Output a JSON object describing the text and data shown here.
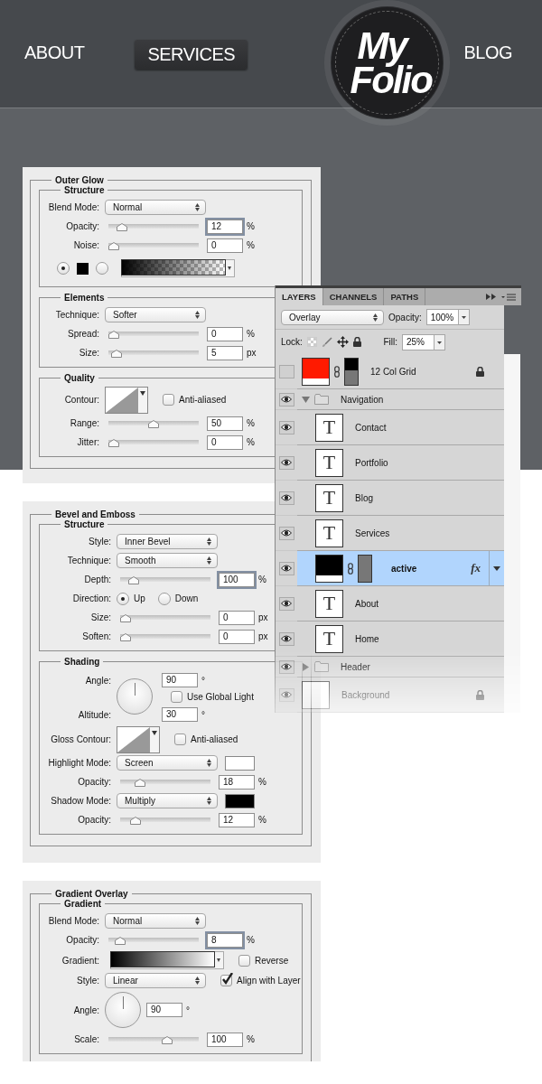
{
  "nav": {
    "items": [
      {
        "label": "ABOUT",
        "selected": false
      },
      {
        "label": "SERVICES",
        "selected": true
      },
      {
        "label": "BLOG",
        "selected": false
      }
    ],
    "logo": {
      "lines": [
        "My",
        "Folio"
      ]
    }
  },
  "panels": [
    {
      "title": "Outer Glow",
      "sections": [
        {
          "title": "Structure",
          "rows": [
            {
              "kind": "select",
              "label": "Blend Mode:",
              "value": "Normal"
            },
            {
              "kind": "slider",
              "label": "Opacity:",
              "level": 0.1,
              "value": "12",
              "unit": "%",
              "focused": true
            },
            {
              "kind": "slider",
              "label": "Noise:",
              "level": 0,
              "value": "0",
              "unit": "%",
              "focused": false
            },
            {
              "kind": "fill",
              "options": [
                {
                  "kind": "color",
                  "selected": true,
                  "color": "#000000"
                },
                {
                  "kind": "gradient",
                  "selected": false
                }
              ]
            }
          ]
        },
        {
          "title": "Elements",
          "rows": [
            {
              "kind": "select",
              "label": "Technique:",
              "value": "Softer"
            },
            {
              "kind": "slider",
              "label": "Spread:",
              "level": 0,
              "value": "0",
              "unit": "%",
              "focused": false
            },
            {
              "kind": "slider",
              "label": "Size:",
              "level": 0.03,
              "value": "5",
              "unit": "px",
              "focused": false
            }
          ]
        },
        {
          "title": "Quality",
          "rows": [
            {
              "kind": "contour",
              "label": "Contour:",
              "checkbox": {
                "label": "Anti-aliased",
                "checked": false
              }
            },
            {
              "kind": "slider",
              "label": "Range:",
              "level": 0.5,
              "value": "50",
              "unit": "%",
              "focused": false
            },
            {
              "kind": "slider",
              "label": "Jitter:",
              "level": 0,
              "value": "0",
              "unit": "%",
              "focused": false
            }
          ]
        }
      ]
    },
    {
      "title": "Bevel and Emboss",
      "sections": [
        {
          "title": "Structure",
          "rows": [
            {
              "kind": "select",
              "label": "Style:",
              "value": "Inner Bevel"
            },
            {
              "kind": "select",
              "label": "Technique:",
              "value": "Smooth"
            },
            {
              "kind": "slider",
              "label": "Depth:",
              "level": 0.1,
              "value": "100",
              "unit": "%",
              "focused": true
            },
            {
              "kind": "radios",
              "label": "Direction:",
              "options": [
                {
                  "label": "Up",
                  "selected": true
                },
                {
                  "label": "Down",
                  "selected": false
                }
              ]
            },
            {
              "kind": "slider",
              "label": "Size:",
              "level": 0,
              "value": "0",
              "unit": "px",
              "focused": false
            },
            {
              "kind": "slider",
              "label": "Soften:",
              "level": 0,
              "value": "0",
              "unit": "px",
              "focused": false
            }
          ]
        },
        {
          "title": "Shading",
          "rows": [
            {
              "kind": "light",
              "angle": {
                "label": "Angle:",
                "value": "90",
                "unit": "°"
              },
              "checkbox": {
                "label": "Use Global Light",
                "checked": false
              },
              "altitude": {
                "label": "Altitude:",
                "value": "30",
                "unit": "°"
              }
            },
            {
              "kind": "contour",
              "label": "Gloss Contour:",
              "checkbox": {
                "label": "Anti-aliased",
                "checked": false
              }
            },
            {
              "kind": "select",
              "label": "Highlight Mode:",
              "value": "Screen",
              "color": "#ffffff"
            },
            {
              "kind": "slider",
              "label": "Opacity:",
              "level": 0.18,
              "value": "18",
              "unit": "%",
              "focused": false
            },
            {
              "kind": "select",
              "label": "Shadow Mode:",
              "value": "Multiply",
              "color": "#000000"
            },
            {
              "kind": "slider",
              "label": "Opacity:",
              "level": 0.12,
              "value": "12",
              "unit": "%",
              "focused": false
            }
          ]
        }
      ]
    },
    {
      "title": "Gradient Overlay",
      "sections": [
        {
          "title": "Gradient",
          "rows": [
            {
              "kind": "select",
              "label": "Blend Mode:",
              "value": "Normal"
            },
            {
              "kind": "slider",
              "label": "Opacity:",
              "level": 0.08,
              "value": "8",
              "unit": "%",
              "focused": true
            },
            {
              "kind": "gradient",
              "label": "Gradient:",
              "checkbox": {
                "label": "Reverse",
                "checked": false
              }
            },
            {
              "kind": "select",
              "label": "Style:",
              "value": "Linear",
              "checkbox": {
                "label": "Align with Layer",
                "checked": true
              }
            },
            {
              "kind": "dial",
              "label": "Angle:",
              "value": "90",
              "unit": "°"
            },
            {
              "kind": "slider",
              "label": "Scale:",
              "level": 0.67,
              "value": "100",
              "unit": "%",
              "focused": false
            }
          ]
        }
      ]
    }
  ],
  "layers_panel": {
    "tabs": [
      {
        "label": "LAYERS",
        "selected": true
      },
      {
        "label": "CHANNELS",
        "selected": false
      },
      {
        "label": "PATHS",
        "selected": false
      }
    ],
    "blend_mode": "Overlay",
    "opacity": {
      "label": "Opacity:",
      "value": "100%"
    },
    "lock_label": "Lock:",
    "fill": {
      "label": "Fill:",
      "value": "25%"
    },
    "layers": [
      {
        "kind": "shape",
        "name": "12 Col Grid",
        "visible": false,
        "selected": false,
        "locked": true,
        "color": "#ff1a00"
      },
      {
        "kind": "group",
        "name": "Navigation",
        "visible": true,
        "selected": false,
        "expanded": true,
        "children": [
          {
            "kind": "text",
            "name": "Contact",
            "visible": true,
            "selected": false,
            "thumbnail": "T"
          },
          {
            "kind": "text",
            "name": "Portfolio",
            "visible": true,
            "selected": false,
            "thumbnail": "T"
          },
          {
            "kind": "text",
            "name": "Blog",
            "visible": true,
            "selected": false,
            "thumbnail": "T"
          },
          {
            "kind": "text",
            "name": "Services",
            "visible": true,
            "selected": false,
            "thumbnail": "T"
          },
          {
            "kind": "shape",
            "name": "active",
            "visible": true,
            "selected": true,
            "locked": false,
            "color": "#000000",
            "effects": "fx"
          },
          {
            "kind": "text",
            "name": "About",
            "visible": true,
            "selected": false,
            "thumbnail": "T"
          },
          {
            "kind": "text",
            "name": "Home",
            "visible": true,
            "selected": false,
            "thumbnail": "T"
          }
        ]
      },
      {
        "kind": "group",
        "name": "Header",
        "visible": true,
        "selected": false,
        "expanded": false
      },
      {
        "kind": "image",
        "name": "Background",
        "visible": true,
        "selected": false,
        "locked": true
      }
    ]
  }
}
